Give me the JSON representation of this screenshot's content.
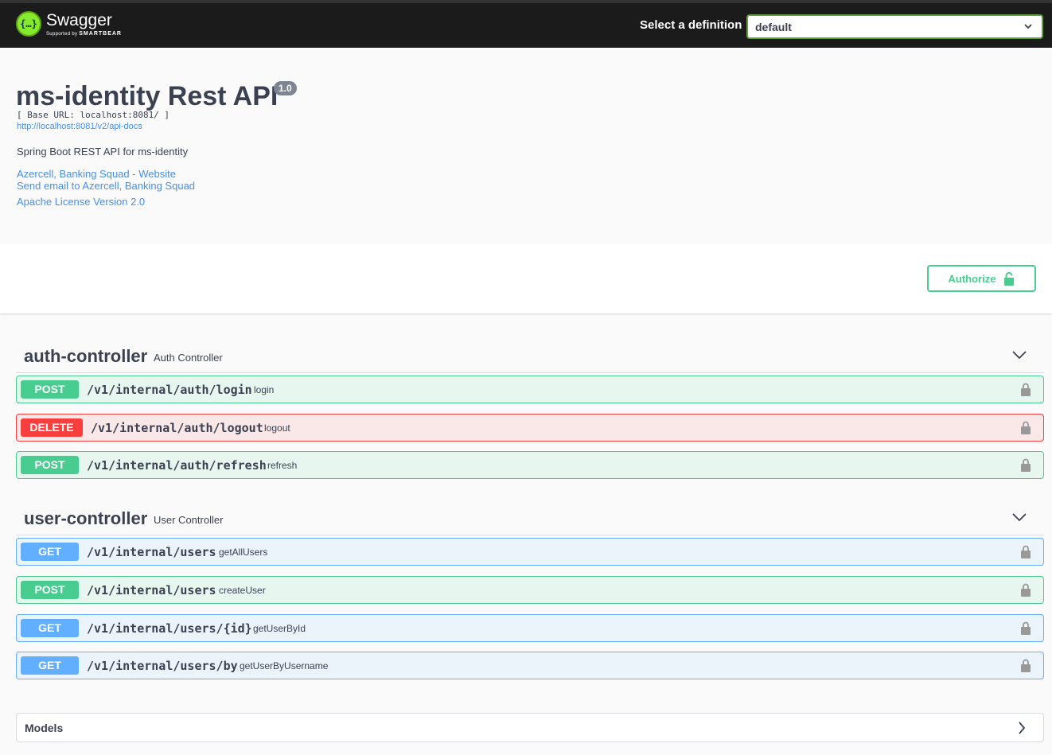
{
  "topbar": {
    "logo_glyph": "{…}",
    "logo_name": "Swagger",
    "logo_sub_prefix": "Supported by",
    "logo_sub_brand": "SMARTBEAR",
    "definition_label": "Select a definition",
    "definition_value": "default"
  },
  "info": {
    "title": "ms-identity Rest API",
    "version": "1.0",
    "base_url": "[ Base URL: localhost:8081/ ]",
    "api_docs_link": "http://localhost:8081/v2/api-docs",
    "description": "Spring Boot REST API for ms-identity",
    "contact_website": "Azercell, Banking Squad - Website",
    "contact_email": "Send email to Azercell, Banking Squad",
    "license": "Apache License Version 2.0"
  },
  "scheme": {
    "authorize_label": "Authorize"
  },
  "tags": [
    {
      "name": "auth-controller",
      "description": "Auth Controller",
      "operations": [
        {
          "method": "POST",
          "path": "/v1/internal/auth/login",
          "summary": "login"
        },
        {
          "method": "DELETE",
          "path": "/v1/internal/auth/logout",
          "summary": "logout"
        },
        {
          "method": "POST",
          "path": "/v1/internal/auth/refresh",
          "summary": "refresh"
        }
      ]
    },
    {
      "name": "user-controller",
      "description": "User Controller",
      "operations": [
        {
          "method": "GET",
          "path": "/v1/internal/users",
          "summary": "getAllUsers"
        },
        {
          "method": "POST",
          "path": "/v1/internal/users",
          "summary": "createUser"
        },
        {
          "method": "GET",
          "path": "/v1/internal/users/{id}",
          "summary": "getUserById"
        },
        {
          "method": "GET",
          "path": "/v1/internal/users/by",
          "summary": "getUserByUsername"
        }
      ]
    }
  ],
  "models": {
    "title": "Models"
  },
  "colors": {
    "post": "#49cc90",
    "delete": "#f93e3e",
    "get": "#61affe",
    "link": "#4990e2",
    "topbar": "#1b1b1b"
  }
}
